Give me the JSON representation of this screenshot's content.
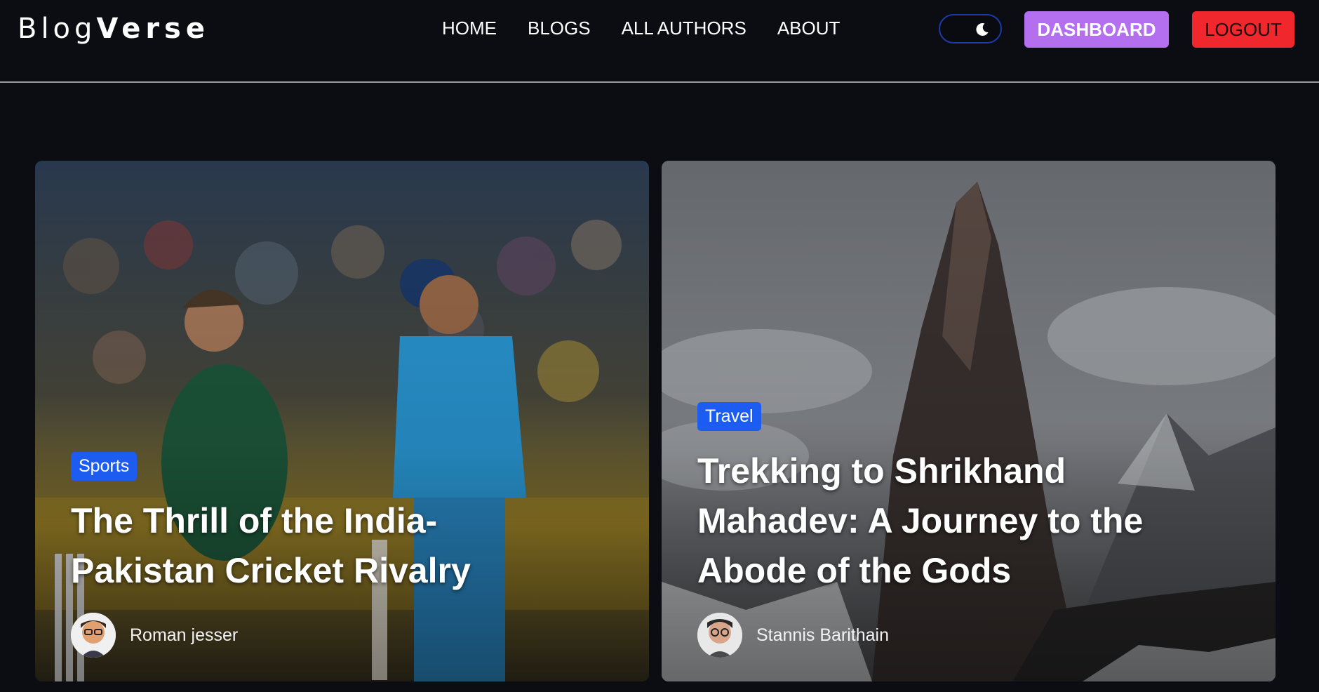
{
  "header": {
    "logo_light": "Blog",
    "logo_bold": "Verse",
    "nav": [
      "HOME",
      "BLOGS",
      "ALL AUTHORS",
      "ABOUT"
    ],
    "dashboard_label": "DASHBOARD",
    "logout_label": "LOGOUT"
  },
  "colors": {
    "background": "#0c0d12",
    "dashboard": "#b36ff0",
    "logout": "#f0282e",
    "badge": "#1d5cf0",
    "toggle_border": "#1c3aa6"
  },
  "icons": {
    "theme_toggle": "moon-icon"
  },
  "cards": [
    {
      "category": "Sports",
      "title": "The Thrill of the India-Pakistan Cricket Rivalry",
      "author": "Roman jesser"
    },
    {
      "category": "Travel",
      "title": "Trekking to Shrikhand Mahadev: A Journey to the Abode of the Gods",
      "author": "Stannis Barithain"
    }
  ]
}
